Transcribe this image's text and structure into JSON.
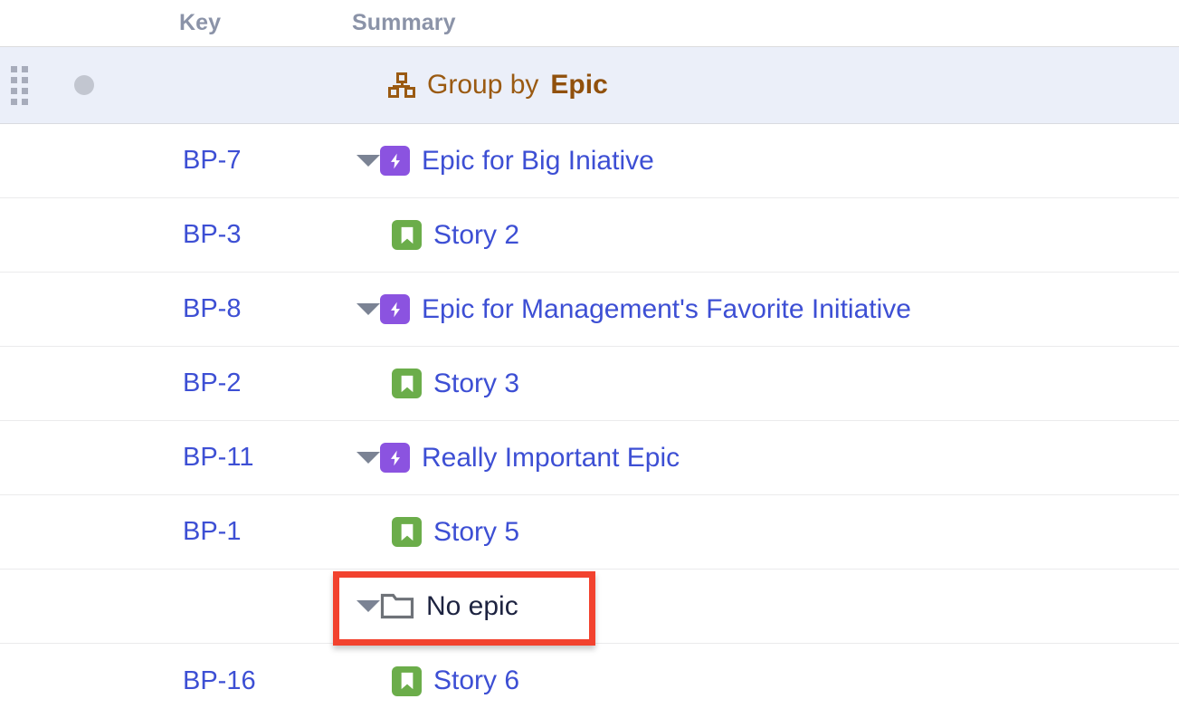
{
  "columns": {
    "handle": "",
    "key": "Key",
    "summary": "Summary"
  },
  "group_banner": {
    "icon": "group-by-hierarchy-icon",
    "prefix": "Group by",
    "field": "Epic",
    "handle_icon": "drag-handle-icon",
    "status_icon": "status-dot-icon",
    "background_color": "#EBEFF9",
    "text_color": "#9A5A12"
  },
  "annotation": {
    "type": "highlight-rectangle",
    "color": "#F2422E",
    "target": "No epic"
  },
  "rows": [
    {
      "key": "BP-7",
      "summary": "Epic for Big Iniative",
      "icon": "epic-icon",
      "icon_color": "#8B53E0",
      "caret": "chevron-down-icon",
      "indent": 0,
      "text_color": "#3D4FD4"
    },
    {
      "key": "BP-3",
      "summary": "Story 2",
      "icon": "story-icon",
      "icon_color": "#6BAD4A",
      "caret": "",
      "indent": 1,
      "text_color": "#3D4FD4"
    },
    {
      "key": "BP-8",
      "summary": "Epic for Management's Favorite Initiative",
      "icon": "epic-icon",
      "icon_color": "#8B53E0",
      "caret": "chevron-down-icon",
      "indent": 0,
      "text_color": "#3D4FD4"
    },
    {
      "key": "BP-2",
      "summary": "Story 3",
      "icon": "story-icon",
      "icon_color": "#6BAD4A",
      "caret": "",
      "indent": 1,
      "text_color": "#3D4FD4"
    },
    {
      "key": "BP-11",
      "summary": "Really Important Epic",
      "icon": "epic-icon",
      "icon_color": "#8B53E0",
      "caret": "chevron-down-icon",
      "indent": 0,
      "text_color": "#3D4FD4"
    },
    {
      "key": "BP-1",
      "summary": "Story 5",
      "icon": "story-icon",
      "icon_color": "#6BAD4A",
      "caret": "",
      "indent": 1,
      "text_color": "#3D4FD4"
    },
    {
      "key": "",
      "summary": "No epic",
      "icon": "folder-icon",
      "icon_color": "#6E7278",
      "caret": "chevron-down-icon",
      "indent": 0,
      "text_color": "#1D2340",
      "highlighted": true
    },
    {
      "key": "BP-16",
      "summary": "Story 6",
      "icon": "story-icon",
      "icon_color": "#6BAD4A",
      "caret": "",
      "indent": 1,
      "text_color": "#3D4FD4"
    }
  ]
}
